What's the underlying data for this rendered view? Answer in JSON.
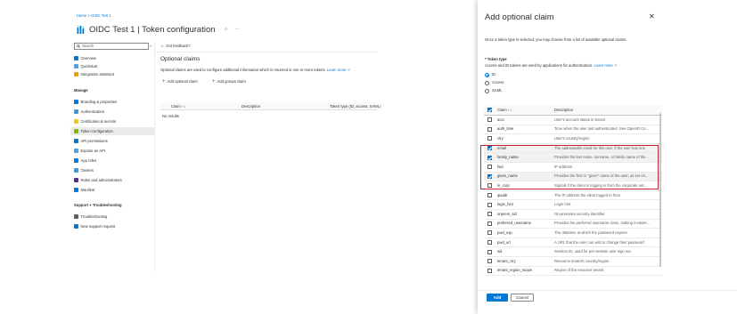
{
  "breadcrumb": {
    "home": "Home",
    "sep": ">",
    "app": "OIDC Test 1"
  },
  "page": {
    "title": "OIDC Test 1 | Token configuration",
    "pin": "⊹",
    "more": "···"
  },
  "sidebar": {
    "search_placeholder": "Search",
    "collapse": "«",
    "items_top": [
      "Overview",
      "Quickstart",
      "Integration assistant"
    ],
    "manage_heading": "Manage",
    "manage_items": [
      "Branding & properties",
      "Authentication",
      "Certificates & secrets",
      "Token configuration",
      "API permissions",
      "Expose an API",
      "App roles",
      "Owners",
      "Roles and administrators",
      "Manifest"
    ],
    "support_heading": "Support + Troubleshooting",
    "support_items": [
      "Troubleshooting",
      "New support request"
    ]
  },
  "content": {
    "feedback": "Got feedback?",
    "section_title": "Optional claims",
    "section_desc": "Optional claims are used to configure additional information which is returned in one or more tokens.",
    "learn_more": "Learn more",
    "add_optional_claim": "Add optional claim",
    "add_groups_claim": "Add groups claim",
    "col_claim": "Claim ↑↓",
    "col_description": "Description",
    "col_token_type": "Token type (ID, access, SAML)",
    "no_results": "No results"
  },
  "panel": {
    "title": "Add optional claim",
    "intro": "Once a token type is selected, you may choose from a list of available optional claims.",
    "token_type_label": "* Token type",
    "token_type_desc": "Access and ID tokens are used by applications for authentication.",
    "learn_more": "Learn more",
    "token_types": [
      "ID",
      "Access",
      "SAML"
    ],
    "col_claim": "Claim ↑↓",
    "col_description": "Description",
    "claims": [
      {
        "name": "acct",
        "desc": "User's account status in tenant",
        "checked": false
      },
      {
        "name": "auth_time",
        "desc": "Time when the user last authenticated. See OpenID Co...",
        "checked": false
      },
      {
        "name": "ctry",
        "desc": "User's country/region",
        "checked": false
      },
      {
        "name": "email",
        "desc": "The addressable email for this user, if the user has one",
        "checked": true
      },
      {
        "name": "family_name",
        "desc": "Provides the last name, surname, or family name of the ...",
        "checked": true
      },
      {
        "name": "fwd",
        "desc": "IP address",
        "checked": false
      },
      {
        "name": "given_name",
        "desc": "Provides the first or \"given\" name of the user, as set on...",
        "checked": true
      },
      {
        "name": "in_corp",
        "desc": "Signals if the client is logging in from the corporate net...",
        "checked": false
      },
      {
        "name": "ipaddr",
        "desc": "The IP address the client logged in from",
        "checked": false
      },
      {
        "name": "login_hint",
        "desc": "Login hint",
        "checked": false
      },
      {
        "name": "onprem_sid",
        "desc": "On-premises security identifier",
        "checked": false
      },
      {
        "name": "preferred_username",
        "desc": "Provides the preferred username claim, making it easier...",
        "checked": false
      },
      {
        "name": "pwd_exp",
        "desc": "The datetime at which the password expires",
        "checked": false
      },
      {
        "name": "pwd_url",
        "desc": "A URL that the user can visit to change their password",
        "checked": false
      },
      {
        "name": "sid",
        "desc": "Session ID, used for per-session user sign out",
        "checked": false
      },
      {
        "name": "tenant_ctry",
        "desc": "Resource tenant's country/region",
        "checked": false
      },
      {
        "name": "tenant_region_scope",
        "desc": "Region of the resource tenant",
        "checked": false
      }
    ],
    "add_label": "Add",
    "cancel_label": "Cancel",
    "close": "✕"
  },
  "colors": {
    "accent": "#0078d4",
    "highlight": "#c4262e",
    "selected_row": "#f3f2f1"
  }
}
